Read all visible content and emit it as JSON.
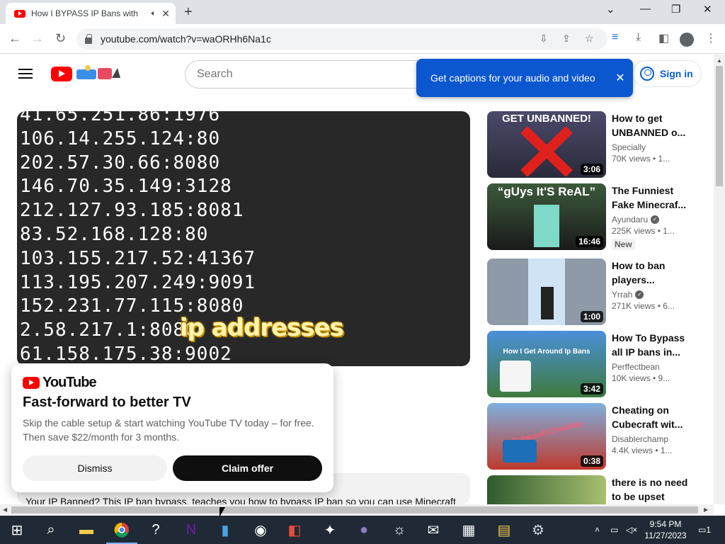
{
  "browser": {
    "tab_title": "How I BYPASS IP Bans with",
    "url": "youtube.com/watch?v=waORHh6Na1c"
  },
  "header": {
    "search_placeholder": "Search",
    "signin_label": "Sign in"
  },
  "caption_tip": {
    "text": "Get captions for your audio and video"
  },
  "player": {
    "ip_lines": [
      "41.65.251.86:1976",
      "106.14.255.124:80",
      "202.57.30.66:8080",
      "146.70.35.149:3128",
      "212.127.93.185:8081",
      "83.52.168.128:80",
      "103.155.217.52:41367",
      "113.195.207.249:9091",
      "152.231.77.115:8080",
      "2.58.217.1:8080",
      "61.158.175.38:9002"
    ],
    "overlay_text": "ip addresses"
  },
  "description": {
    "text": "Your IP Banned? This IP ban bypass, teaches you how to bypass IP ban so you can use Minecraft"
  },
  "promo": {
    "brand": "YouTube",
    "title": "Fast-forward to better TV",
    "body": "Skip the cable setup & start watching YouTube TV today – for free. Then save $22/month for 3 months.",
    "dismiss_label": "Dismiss",
    "claim_label": "Claim offer"
  },
  "recommendations": [
    {
      "title": "How to get UNBANNED o...",
      "channel": "Specially",
      "meta": "70K views • 1...",
      "duration": "3:06",
      "thumb_text": "GET UNBANNED!",
      "verified": false,
      "badge": ""
    },
    {
      "title": "The Funniest Fake Minecraf...",
      "channel": "Ayundaru",
      "meta": "225K views • 1...",
      "duration": "16:46",
      "thumb_text": "“gUys It'S ReAL”",
      "verified": true,
      "badge": "New"
    },
    {
      "title": "How to ban players...",
      "channel": "Yrrah",
      "meta": "271K views • 6...",
      "duration": "1:00",
      "thumb_text": "",
      "verified": true,
      "badge": ""
    },
    {
      "title": "How To Bypass all IP bans in...",
      "channel": "Perffectbean",
      "meta": "10K views • 9...",
      "duration": "3:42",
      "thumb_text": "How I Get Around Ip Bans",
      "verified": false,
      "badge": ""
    },
    {
      "title": "Cheating on Cubecraft wit...",
      "channel": "Disablerchamp",
      "meta": "4.4K views • 1...",
      "duration": "0:38",
      "thumb_text": "Cubecraft Cheating",
      "verified": false,
      "badge": ""
    },
    {
      "title": "there is no need to be upset",
      "channel": "",
      "meta": "",
      "duration": "",
      "thumb_text": "",
      "verified": false,
      "badge": ""
    }
  ],
  "taskbar": {
    "time": "9:54 PM",
    "date": "11/27/2023",
    "notification_count": "1"
  },
  "colors": {
    "youtube_red": "#ff0000",
    "tip_blue": "#0b57d0",
    "link_blue": "#065fd4"
  }
}
